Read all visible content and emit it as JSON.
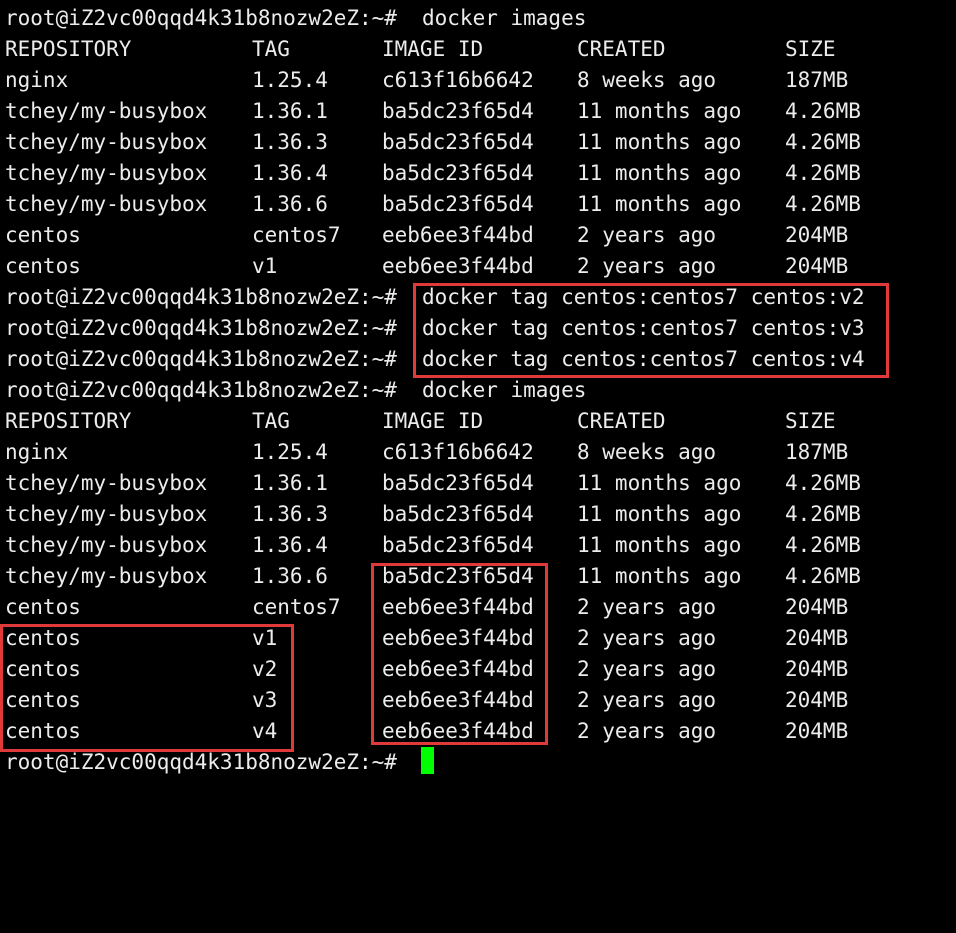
{
  "terminal": {
    "prompt": "root@iZ2vc00qqd4k31b8nozw2eZ:~#",
    "command_images": "docker images",
    "tag_commands": [
      "docker tag centos:centos7 centos:v2",
      "docker tag centos:centos7 centos:v3",
      "docker tag centos:centos7 centos:v4"
    ],
    "headers": [
      "REPOSITORY",
      "TAG",
      "IMAGE ID",
      "CREATED",
      "SIZE"
    ],
    "table_before": [
      [
        "nginx",
        "1.25.4",
        "c613f16b6642",
        "8 weeks ago",
        "187MB"
      ],
      [
        "tchey/my-busybox",
        "1.36.1",
        "ba5dc23f65d4",
        "11 months ago",
        "4.26MB"
      ],
      [
        "tchey/my-busybox",
        "1.36.3",
        "ba5dc23f65d4",
        "11 months ago",
        "4.26MB"
      ],
      [
        "tchey/my-busybox",
        "1.36.4",
        "ba5dc23f65d4",
        "11 months ago",
        "4.26MB"
      ],
      [
        "tchey/my-busybox",
        "1.36.6",
        "ba5dc23f65d4",
        "11 months ago",
        "4.26MB"
      ],
      [
        "centos",
        "centos7",
        "eeb6ee3f44bd",
        "2 years ago",
        "204MB"
      ],
      [
        "centos",
        "v1",
        "eeb6ee3f44bd",
        "2 years ago",
        "204MB"
      ]
    ],
    "table_after": [
      [
        "nginx",
        "1.25.4",
        "c613f16b6642",
        "8 weeks ago",
        "187MB"
      ],
      [
        "tchey/my-busybox",
        "1.36.1",
        "ba5dc23f65d4",
        "11 months ago",
        "4.26MB"
      ],
      [
        "tchey/my-busybox",
        "1.36.3",
        "ba5dc23f65d4",
        "11 months ago",
        "4.26MB"
      ],
      [
        "tchey/my-busybox",
        "1.36.4",
        "ba5dc23f65d4",
        "11 months ago",
        "4.26MB"
      ],
      [
        "tchey/my-busybox",
        "1.36.6",
        "ba5dc23f65d4",
        "11 months ago",
        "4.26MB"
      ],
      [
        "centos",
        "centos7",
        "eeb6ee3f44bd",
        "2 years ago",
        "204MB"
      ],
      [
        "centos",
        "v1",
        "eeb6ee3f44bd",
        "2 years ago",
        "204MB"
      ],
      [
        "centos",
        "v2",
        "eeb6ee3f44bd",
        "2 years ago",
        "204MB"
      ],
      [
        "centos",
        "v3",
        "eeb6ee3f44bd",
        "2 years ago",
        "204MB"
      ],
      [
        "centos",
        "v4",
        "eeb6ee3f44bd",
        "2 years ago",
        "204MB"
      ]
    ]
  },
  "colors": {
    "background": "#000000",
    "text": "#ececec",
    "highlight_box": "#e0393a",
    "cursor": "#00ff00"
  }
}
